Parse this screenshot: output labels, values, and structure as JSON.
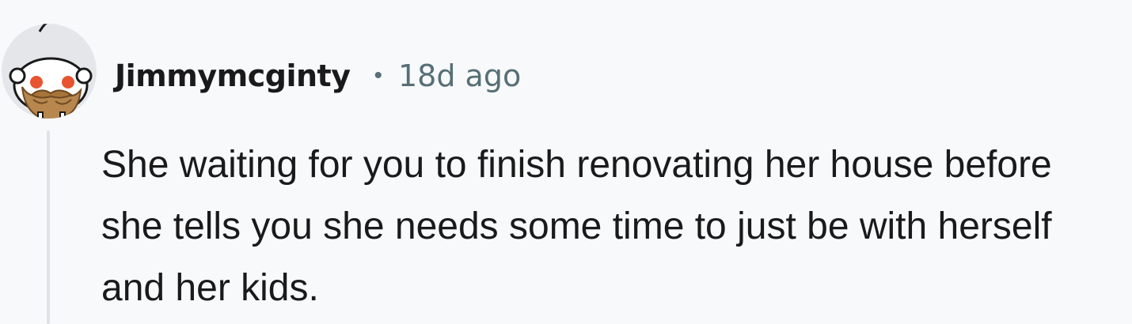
{
  "comment": {
    "author": "Jimmymcginty",
    "separator": "•",
    "timestamp": "18d ago",
    "body": "She waiting for you to finish renovating her house before she tells you she needs some time to just be with herself and her kids.",
    "avatar_icon": "snoo-avatar-icon"
  },
  "colors": {
    "background": "#f8f9fb",
    "text": "#1a1a1b",
    "meta_text": "#576f76",
    "thread_line": "#dfe3e8",
    "avatar_beard": "#b8874e",
    "avatar_eyes": "#e8542f"
  }
}
